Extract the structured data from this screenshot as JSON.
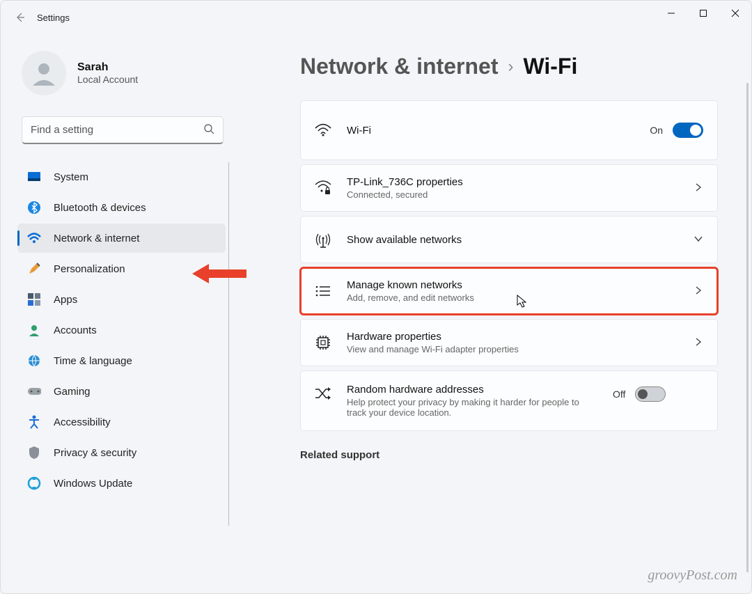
{
  "window": {
    "title": "Settings"
  },
  "account": {
    "name": "Sarah",
    "type": "Local Account"
  },
  "search": {
    "placeholder": "Find a setting"
  },
  "nav": {
    "items": [
      {
        "label": "System"
      },
      {
        "label": "Bluetooth & devices"
      },
      {
        "label": "Network & internet"
      },
      {
        "label": "Personalization"
      },
      {
        "label": "Apps"
      },
      {
        "label": "Accounts"
      },
      {
        "label": "Time & language"
      },
      {
        "label": "Gaming"
      },
      {
        "label": "Accessibility"
      },
      {
        "label": "Privacy & security"
      },
      {
        "label": "Windows Update"
      }
    ]
  },
  "breadcrumb": {
    "parent": "Network & internet",
    "current": "Wi-Fi"
  },
  "cards": {
    "wifi": {
      "title": "Wi-Fi",
      "state_label": "On"
    },
    "properties": {
      "title": "TP-Link_736C properties",
      "sub": "Connected, secured"
    },
    "available": {
      "title": "Show available networks"
    },
    "known": {
      "title": "Manage known networks",
      "sub": "Add, remove, and edit networks"
    },
    "hardware": {
      "title": "Hardware properties",
      "sub": "View and manage Wi-Fi adapter properties"
    },
    "random": {
      "title": "Random hardware addresses",
      "sub": "Help protect your privacy by making it harder for people to track your device location.",
      "state_label": "Off"
    }
  },
  "related": {
    "title": "Related support"
  },
  "watermark": "groovyPost.com"
}
